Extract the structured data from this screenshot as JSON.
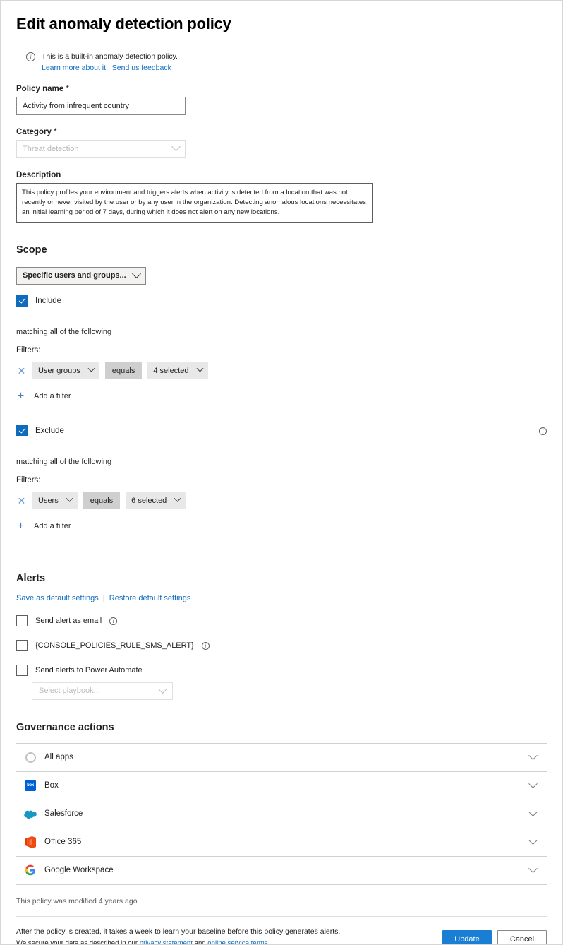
{
  "header": {
    "title": "Edit anomaly detection policy",
    "info_icon": "info-circle-icon",
    "banner_text": "This is a built-in anomaly detection policy.",
    "learn_more_link": "Learn more about it",
    "separator": "|",
    "feedback_link": "Send us feedback"
  },
  "form": {
    "policy_name_label": "Policy name",
    "required_marker": "*",
    "policy_name_value": "Activity from infrequent country",
    "policy_name_placeholder": "Policy name",
    "category_label": "Category",
    "category_value": "Threat detection",
    "description_label": "Description",
    "description_value": "This policy profiles your environment and triggers alerts when activity is detected from a location that was not recently or never visited by the user or by any user in the organization. Detecting anomalous locations necessitates an initial learning period of 7 days, during which it does not alert on any new locations."
  },
  "scope": {
    "title": "Scope",
    "dropdown_value": "Specific users and groups...",
    "include": {
      "label": "Include",
      "checked": true,
      "matching_text": "matching all of the following",
      "filters_label": "Filters:",
      "remove_icon": "close-icon",
      "field": "User groups",
      "operator": "equals",
      "value": "4 selected",
      "add_filter_label": "Add a filter",
      "add_icon": "plus-icon"
    },
    "exclude": {
      "label": "Exclude",
      "checked": true,
      "info_icon": "info-circle-icon",
      "matching_text": "matching all of the following",
      "filters_label": "Filters:",
      "remove_icon": "close-icon",
      "field": "Users",
      "operator": "equals",
      "value": "6 selected",
      "add_filter_label": "Add a filter",
      "add_icon": "plus-icon"
    }
  },
  "alerts": {
    "title": "Alerts",
    "save_defaults_link": "Save as default settings",
    "separator": "|",
    "restore_defaults_link": "Restore default settings",
    "options": [
      {
        "label": "Send alert as email",
        "checked": false,
        "has_info": true
      },
      {
        "label": "{CONSOLE_POLICIES_RULE_SMS_ALERT}",
        "checked": false,
        "has_info": true
      },
      {
        "label": "Send alerts to Power Automate",
        "checked": false,
        "has_info": false
      }
    ],
    "playbook_placeholder": "Select playbook..."
  },
  "governance": {
    "title": "Governance actions",
    "rows": [
      {
        "name": "All apps",
        "icon": "all-apps-icon"
      },
      {
        "name": "Box",
        "icon": "box-icon"
      },
      {
        "name": "Salesforce",
        "icon": "salesforce-icon"
      },
      {
        "name": "Office 365",
        "icon": "office365-icon"
      },
      {
        "name": "Google Workspace",
        "icon": "google-workspace-icon"
      }
    ],
    "expand_icon": "chevron-down-icon"
  },
  "footer": {
    "modified_text": "This policy was modified 4 years ago",
    "legal_line1": "After the policy is created, it takes a week to learn your baseline before this policy generates alerts.",
    "legal_line2_prefix": "We secure your data as described in our ",
    "privacy_link": "privacy statement",
    "legal_line2_mid": " and ",
    "terms_link": "online service terms",
    "legal_line2_suffix": ".",
    "update_button": "Update",
    "cancel_button": "Cancel"
  },
  "colors": {
    "accent": "#0f6cbd",
    "primary_button": "#1a7fd4",
    "link": "#0f6cbd"
  }
}
